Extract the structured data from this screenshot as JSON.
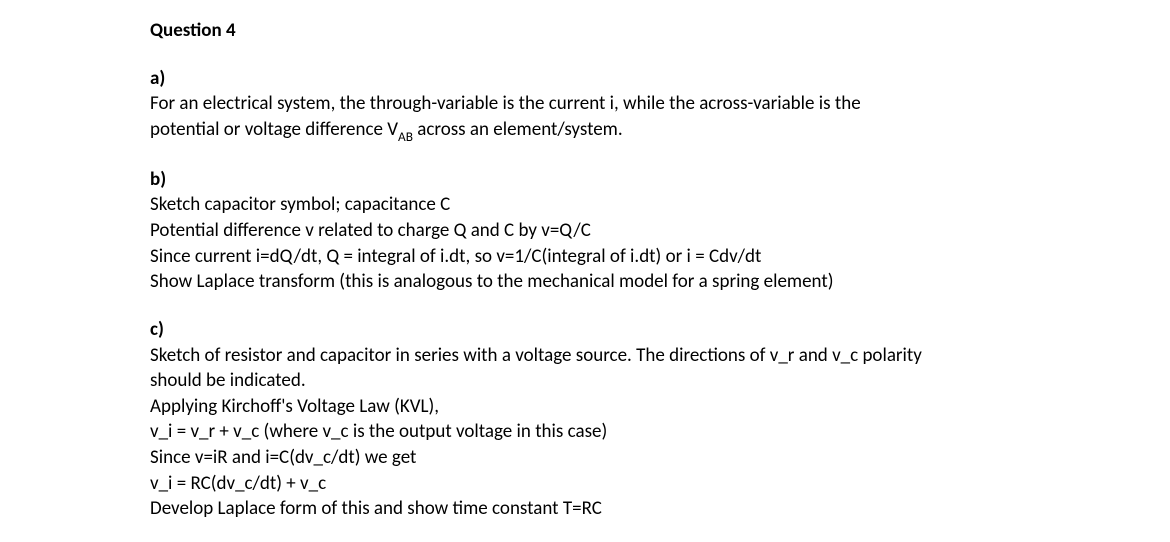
{
  "title": "Question 4",
  "sections": {
    "a": {
      "label": "a)",
      "lines": [
        "For an electrical system, the through-variable is the current i, while the across-variable is the",
        "potential or voltage difference VAB across an element/system."
      ],
      "sub_token": "VAB",
      "sub_replace_base": "V",
      "sub_replace_sub": "AB"
    },
    "b": {
      "label": "b)",
      "lines": [
        "Sketch capacitor symbol; capacitance C",
        "Potential difference v related to charge Q and C by v=Q/C",
        "Since current i=dQ/dt, Q = integral of i.dt, so v=1/C(integral of i.dt) or i = Cdv/dt",
        "Show Laplace transform (this is analogous to the mechanical model for a spring element)"
      ]
    },
    "c": {
      "label": "c)",
      "lines": [
        "Sketch of resistor and capacitor in series with a voltage source. The directions of v_r and v_c polarity",
        "should be indicated.",
        "Applying Kirchoff's Voltage Law (KVL),",
        "v_i = v_r + v_c (where v_c is the output voltage in this case)",
        "Since v=iR and i=C(dv_c/dt) we get",
        "v_i = RC(dv_c/dt) + v_c",
        "Develop Laplace form of this and show time constant T=RC"
      ]
    }
  }
}
